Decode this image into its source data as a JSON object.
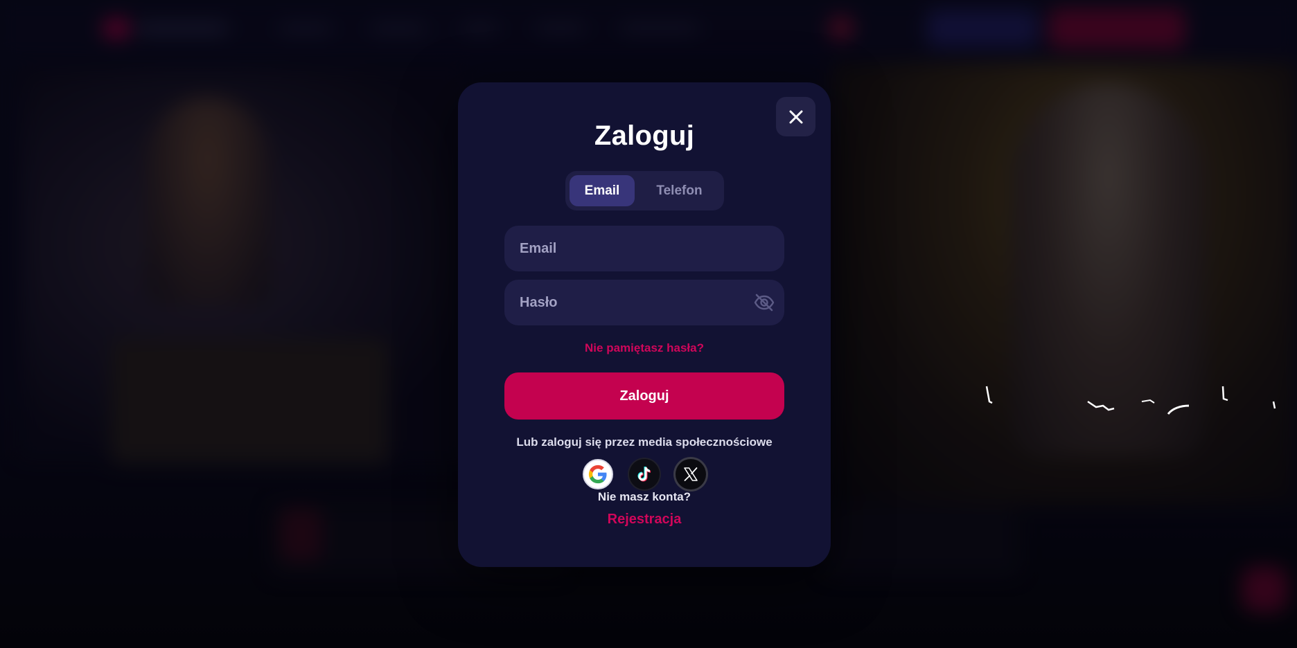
{
  "modal": {
    "title": "Zaloguj",
    "tabs": [
      {
        "label": "Email",
        "active": true
      },
      {
        "label": "Telefon",
        "active": false
      }
    ],
    "email_field": {
      "placeholder": "Email",
      "value": ""
    },
    "password_field": {
      "placeholder": "Hasło",
      "value": "",
      "toggle_icon": "eye-off-icon"
    },
    "forgot_password": "Nie pamiętasz hasła?",
    "submit_label": "Zaloguj",
    "social_label": "Lub zaloguj się przez media społecznościowe",
    "social_providers": [
      {
        "name": "google",
        "icon": "google-icon"
      },
      {
        "name": "tiktok",
        "icon": "tiktok-icon"
      },
      {
        "name": "x",
        "icon": "x-icon"
      }
    ],
    "no_account": "Nie masz konta?",
    "register_label": "Rejestracja",
    "close_icon": "close-icon"
  },
  "colors": {
    "modal_bg": "#121233",
    "accent": "#c4024f",
    "link": "#d0065a",
    "input_bg": "#1f1e47",
    "tab_active_bg": "#38357a"
  }
}
